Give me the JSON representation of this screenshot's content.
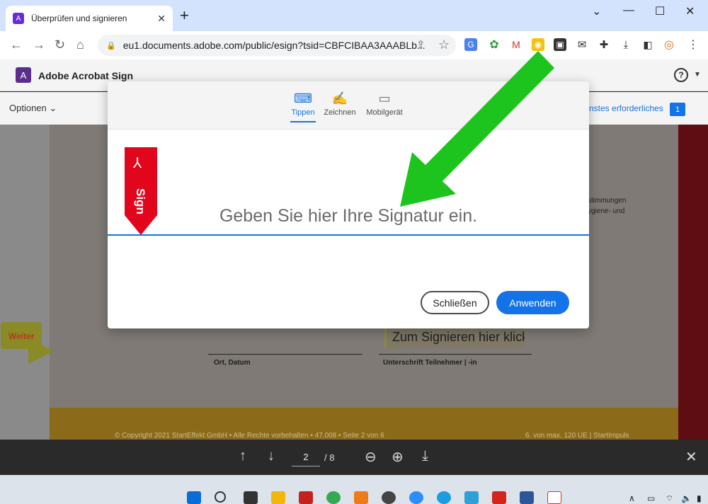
{
  "browser": {
    "tab_title": "Überprüfen und signieren",
    "url": "eu1.documents.adobe.com/public/esign?tsid=CBFCIBAA3AAABLb..."
  },
  "app": {
    "name": "Adobe Acrobat Sign",
    "options_label": "Optionen",
    "required_label": "nstes erforderliches",
    "required_count": "1"
  },
  "document": {
    "side_text": [
      "stimmungen",
      "ygiene- und"
    ],
    "place_date_label": "Ort, Datum",
    "signature_label": "Unterschrift Teilnehmer | -in",
    "sign_here_button": "Zum Signieren hier klick",
    "copyright": "© Copyright 2021 StartEffekt GmbH • Alle Rechte vorbehalten • 47.008 • Seite 2 von 6",
    "units": "6. von max. 120 UE | StartImpuls",
    "next_label": "Weiter"
  },
  "modal": {
    "tabs": [
      {
        "label": "Tippen",
        "icon": "keyboard-icon",
        "active": true
      },
      {
        "label": "Zeichnen",
        "icon": "pen-icon",
        "active": false
      },
      {
        "label": "Mobilgerät",
        "icon": "mobile-icon",
        "active": false
      }
    ],
    "bookmark_text": "Sign",
    "placeholder": "Geben Sie hier Ihre Signatur ein.",
    "close_button": "Schließen",
    "apply_button": "Anwenden"
  },
  "pdf_toolbar": {
    "current_page": "2",
    "total_pages": "/ 8"
  },
  "colors": {
    "accent_blue": "#1473e6",
    "adobe_red": "#e1061b",
    "arrow_green": "#1ec41e"
  }
}
